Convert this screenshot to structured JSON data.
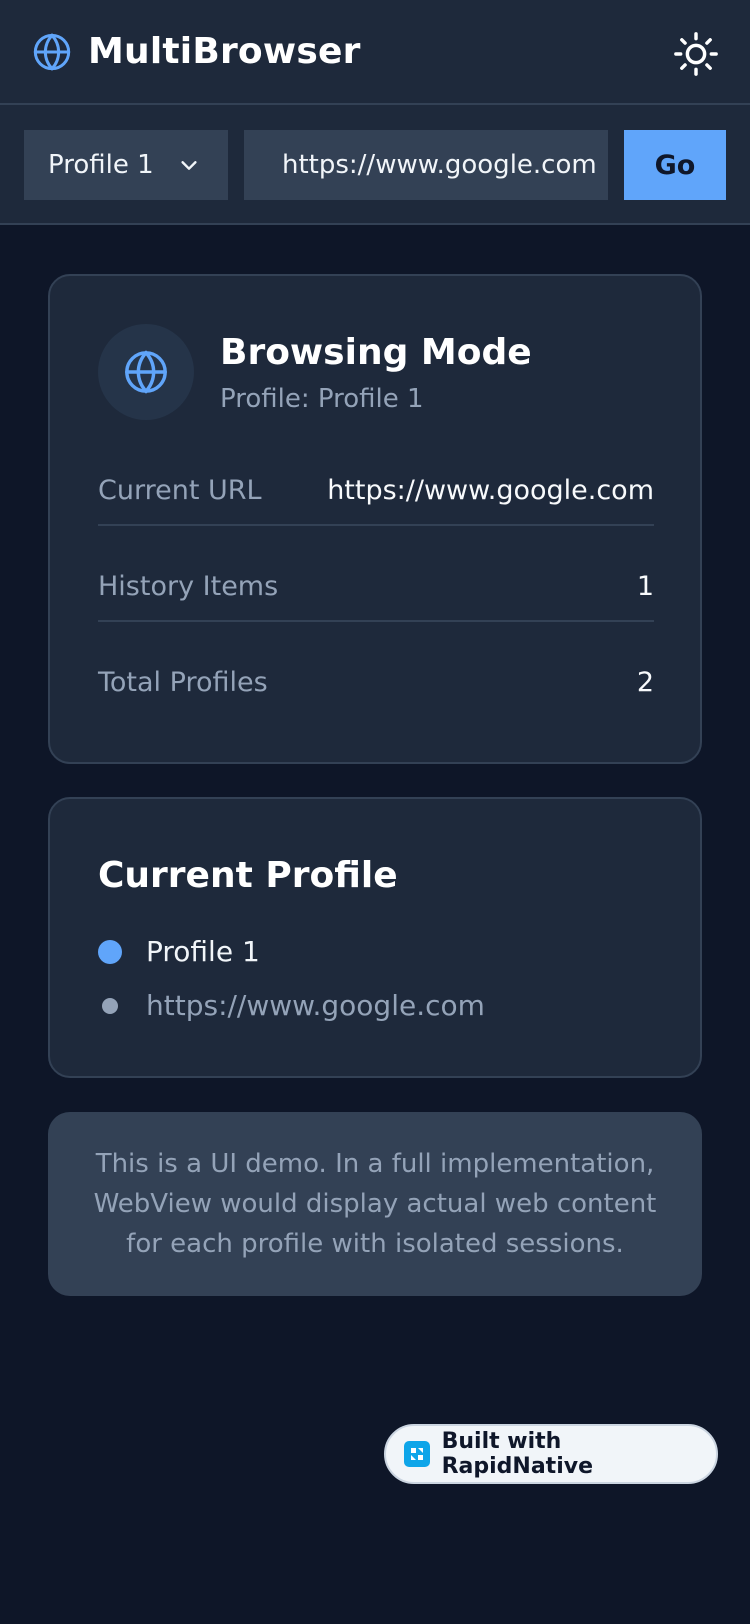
{
  "header": {
    "title": "MultiBrowser",
    "logo_icon": "globe-icon",
    "theme_icon": "sun-icon"
  },
  "toolbar": {
    "profile_selected": "Profile 1",
    "url_value": "https://www.google.com",
    "go_label": "Go"
  },
  "mode_card": {
    "title": "Browsing Mode",
    "subtitle": "Profile: Profile 1",
    "stats": [
      {
        "label": "Current URL",
        "value": "https://www.google.com"
      },
      {
        "label": "History Items",
        "value": "1"
      },
      {
        "label": "Total Profiles",
        "value": "2"
      }
    ]
  },
  "current_profile": {
    "title": "Current Profile",
    "name": "Profile 1",
    "url": "https://www.google.com"
  },
  "notice": {
    "text": "This is a UI demo. In a full implementation, WebView would display actual web content for each profile with isolated sessions."
  },
  "badge": {
    "label": "Built with RapidNative"
  },
  "colors": {
    "background": "#0e1628",
    "surface": "#1e293b",
    "border": "#334155",
    "accent": "#60a5fa",
    "muted_text": "#94a3b8"
  }
}
